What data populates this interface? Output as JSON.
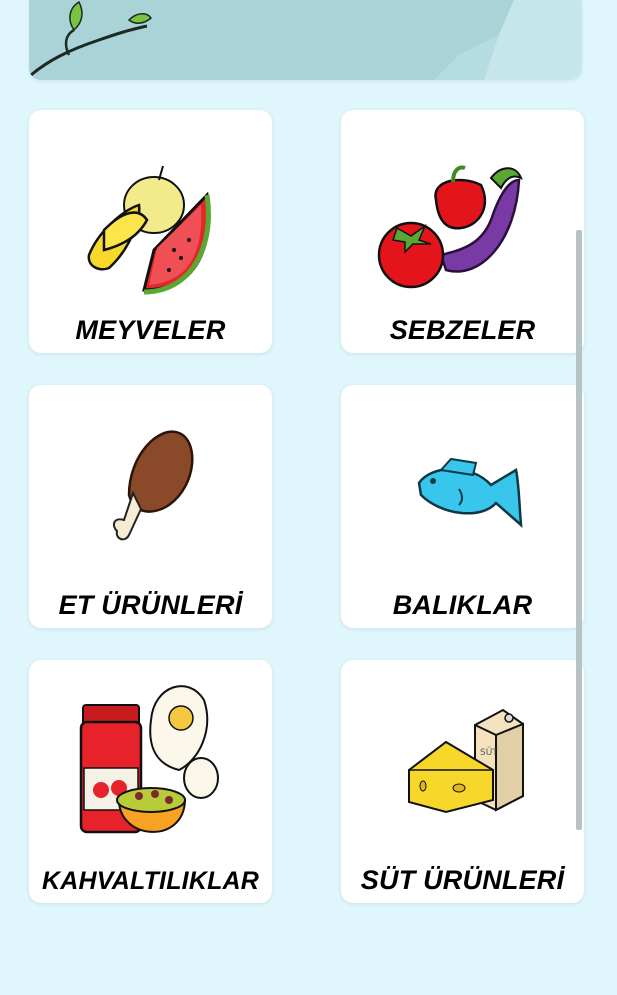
{
  "categories": [
    {
      "label": "MEYVELER",
      "icon": "fruits-icon"
    },
    {
      "label": "SEBZELER",
      "icon": "vegetables-icon"
    },
    {
      "label": "ET ÜRÜNLERİ",
      "icon": "meat-icon"
    },
    {
      "label": "BALIKLAR",
      "icon": "fish-icon"
    },
    {
      "label": "KAHVALTILIKLAR",
      "icon": "breakfast-icon"
    },
    {
      "label": "SÜT ÜRÜNLERİ",
      "icon": "dairy-icon"
    }
  ],
  "dairy_carton_text": "SÜT",
  "colors": {
    "background": "#dff7fc",
    "card": "#ffffff",
    "banner": "#a9d3d7"
  }
}
